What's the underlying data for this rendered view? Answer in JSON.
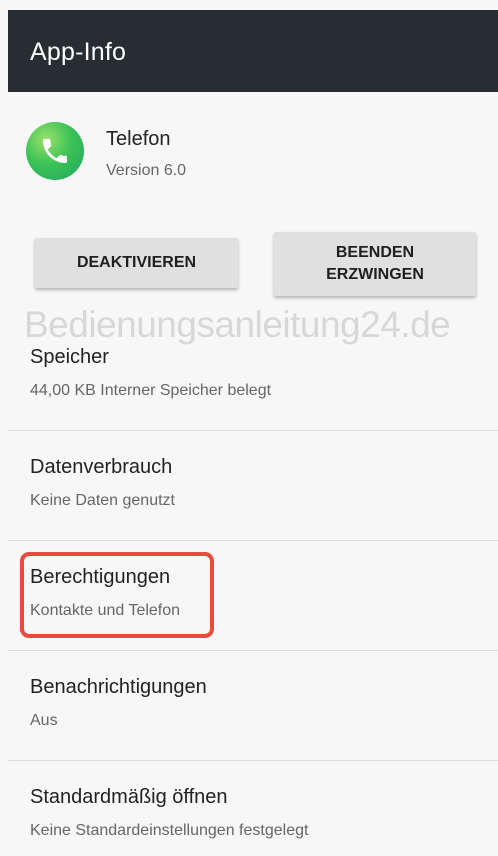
{
  "header": {
    "title": "App-Info"
  },
  "app": {
    "name": "Telefon",
    "version": "Version 6.0",
    "icon": "phone-icon"
  },
  "buttons": {
    "deactivate": "DEAKTIVIEREN",
    "force_stop_line1": "BEENDEN",
    "force_stop_line2": "ERZWINGEN"
  },
  "rows": [
    {
      "title": "Speicher",
      "subtitle": "44,00 KB Interner Speicher belegt"
    },
    {
      "title": "Datenverbrauch",
      "subtitle": "Keine Daten genutzt"
    },
    {
      "title": "Berechtigungen",
      "subtitle": "Kontakte und Telefon"
    },
    {
      "title": "Benachrichtigungen",
      "subtitle": "Aus"
    },
    {
      "title": "Standardmäßig öffnen",
      "subtitle": "Keine Standardeinstellungen festgelegt"
    }
  ],
  "watermark": "Bedienungsanleitung24.de",
  "colors": {
    "appbar": "#262d33",
    "highlight": "#e74c3c",
    "icon_green": "#3cc257"
  }
}
